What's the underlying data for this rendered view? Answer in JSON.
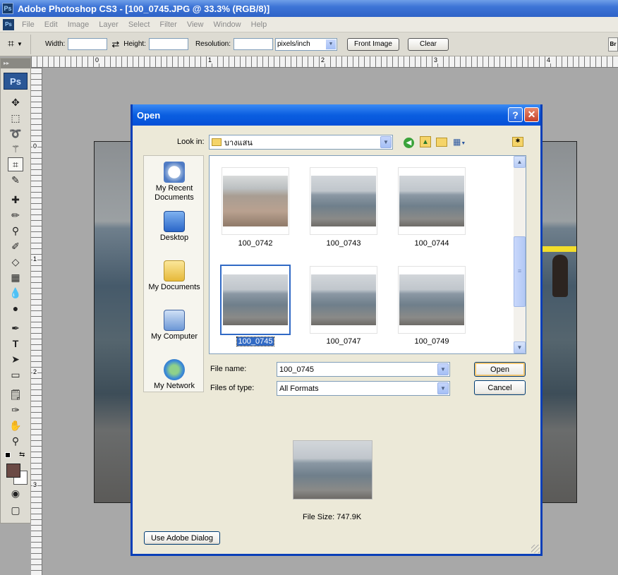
{
  "app": {
    "window_title": "Adobe Photoshop CS3 - [100_0745.JPG @ 33.3% (RGB/8)]",
    "logo_text": "Ps"
  },
  "menu": [
    "File",
    "Edit",
    "Image",
    "Layer",
    "Select",
    "Filter",
    "View",
    "Window",
    "Help"
  ],
  "options_bar": {
    "width_label": "Width:",
    "width_value": "",
    "height_label": "Height:",
    "height_value": "",
    "resolution_label": "Resolution:",
    "resolution_value": "",
    "resolution_unit": "pixels/inch",
    "front_image_label": "Front Image",
    "clear_label": "Clear",
    "right_edge_text": "Br"
  },
  "rulers": {
    "horizontal": [
      "0",
      "1",
      "2",
      "3",
      "4"
    ],
    "vertical": [
      "0",
      "1",
      "2",
      "3"
    ]
  },
  "dialog": {
    "title": "Open",
    "help_label": "?",
    "close_label": "✕",
    "look_in_label": "Look in:",
    "look_in_value": "บางแสน",
    "places": [
      {
        "label": "My Recent Documents",
        "icon": "recent-documents-icon"
      },
      {
        "label": "Desktop",
        "icon": "desktop-icon"
      },
      {
        "label": "My Documents",
        "icon": "my-documents-icon"
      },
      {
        "label": "My Computer",
        "icon": "my-computer-icon"
      },
      {
        "label": "My Network",
        "icon": "my-network-icon"
      }
    ],
    "files": [
      {
        "name": "100_0742",
        "selected": false
      },
      {
        "name": "100_0743",
        "selected": false
      },
      {
        "name": "100_0744",
        "selected": false
      },
      {
        "name": "100_0745",
        "selected": true
      },
      {
        "name": "100_0747",
        "selected": false
      },
      {
        "name": "100_0749",
        "selected": false
      }
    ],
    "file_name_label": "File name:",
    "file_name_value": "100_0745",
    "files_of_type_label": "Files of type:",
    "files_of_type_value": "All Formats",
    "open_label": "Open",
    "cancel_label": "Cancel",
    "file_size_text": "File Size: 747.9K",
    "use_adobe_dialog_label": "Use Adobe Dialog"
  },
  "colors": {
    "xp_blue": "#0a5ee0",
    "selection": "#316ac5",
    "foreground_swatch": "#6b4a45",
    "background_swatch": "#ffffff"
  }
}
